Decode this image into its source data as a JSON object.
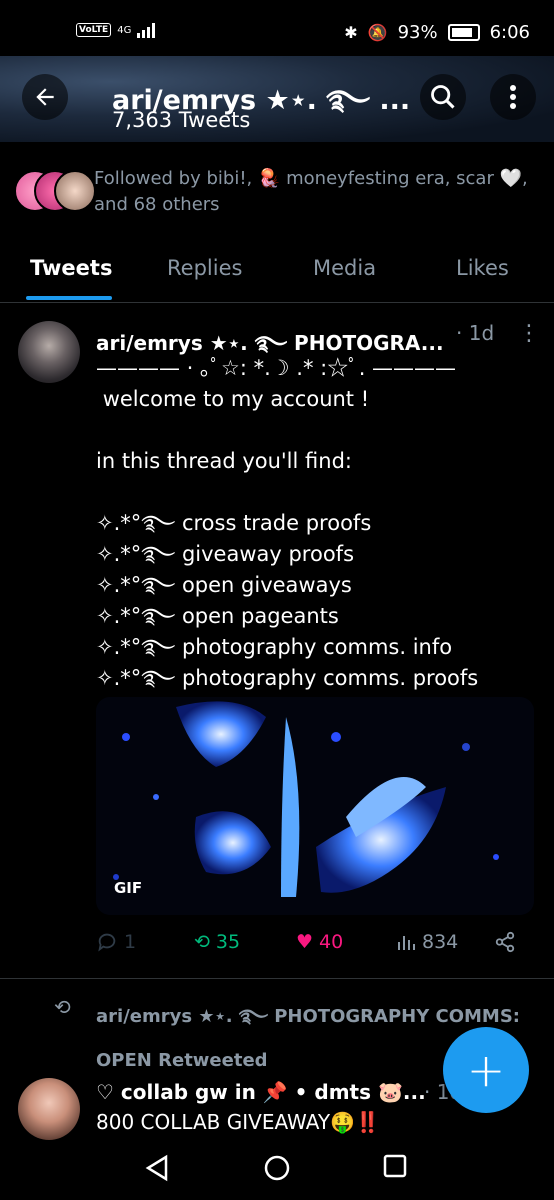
{
  "status_bar": {
    "network": "VoLTE",
    "signal": "4G",
    "battery": "93%",
    "time": "6:06"
  },
  "header": {
    "title": "ari/emrys ★⋆. ࿐ ...",
    "subtitle": "7,363 Tweets"
  },
  "followers": {
    "text": "Followed by bibi!, 🪼 moneyfesting era, scar 🤍, and 68 others"
  },
  "tabs": [
    {
      "label": "Tweets",
      "active": true
    },
    {
      "label": "Replies",
      "active": false
    },
    {
      "label": "Media",
      "active": false
    },
    {
      "label": "Likes",
      "active": false
    }
  ],
  "tweet1": {
    "name": "ari/emrys ★⋆. ࿐ PHOTOGRA...",
    "time": "· 1d",
    "body": "———— ⋅ ｡ﾟ☆: *.☽ .* :☆ﾟ. ————\n welcome to my account !\n\nin this thread you'll find:\n\n✧.*°࿐ cross trade proofs\n✧.*°࿐ giveaway proofs\n✧.*°࿐ open giveaways\n✧.*°࿐ open pageants\n✧.*°࿐ photography comms. info\n✧.*°࿐ photography comms. proofs",
    "media_badge": "GIF",
    "replies": "1",
    "retweets": "35",
    "likes": "40",
    "views": "834"
  },
  "retweet_context": {
    "text": "ari/emrys ★⋆. ࿐ PHOTOGRAPHY COMMS: OPEN Retweeted"
  },
  "tweet2": {
    "name": "♡ collab gw in 📌 • dmts 🐷...",
    "time": "· 1d",
    "body": "800 COLLAB GIVEAWAY🤑‼️"
  },
  "fab": {
    "label": "+"
  },
  "colors": {
    "accent": "#1d9bf0",
    "retweet": "#00ba7c",
    "like": "#f91880",
    "muted": "#8b98a5"
  }
}
